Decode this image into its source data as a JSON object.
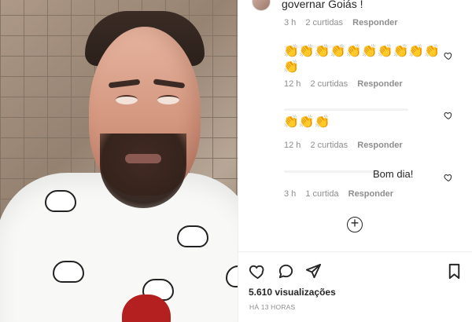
{
  "post": {
    "caption": "governar Goiás !",
    "views": "5.610 visualizações",
    "posted_time": "HÁ 13 HORAS"
  },
  "comments": [
    {
      "text": "",
      "emoji": "👏👏👏👏👏👏👏👏👏👏👏",
      "age": "12 h",
      "likes": "2 curtidas",
      "reply": "Responder"
    },
    {
      "text": "",
      "emoji": "👏👏👏",
      "age": "12 h",
      "likes": "2 curtidas",
      "reply": "Responder"
    },
    {
      "text": "Bom dia!",
      "emoji": "",
      "age": "3 h",
      "likes": "1 curtida",
      "reply": "Responder"
    }
  ],
  "top_meta": {
    "age": "3 h",
    "likes": "2 curtidas",
    "reply": "Responder"
  },
  "icons": {
    "like": "heart-icon",
    "comment": "comment-icon",
    "share": "send-icon",
    "save": "bookmark-icon",
    "add_comments": "plus-circle-icon"
  },
  "colors": {
    "text": "#262626",
    "muted": "#8e8e8e",
    "background": "#ffffff"
  }
}
